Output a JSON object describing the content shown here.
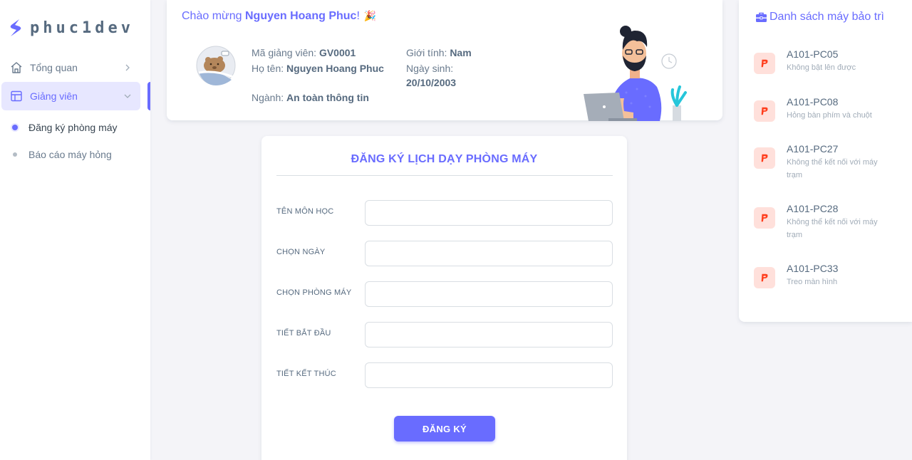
{
  "sidebar": {
    "brand": "phuc1dev",
    "menu": [
      {
        "label": "Tổng quan",
        "icon": "home-icon"
      },
      {
        "label": "Giảng viên",
        "icon": "layout-icon"
      }
    ],
    "submenu": [
      {
        "label": "Đăng ký phòng máy"
      },
      {
        "label": "Báo cáo máy hỏng"
      }
    ]
  },
  "welcome": {
    "greeting": "Chào mừng ",
    "name": "Nguyen Hoang Phuc",
    "suffix": "!",
    "emoji": "🎉",
    "teacher_id_label": "Mã giảng viên: ",
    "teacher_id": "GV0001",
    "fullname_label": "Họ tên: ",
    "fullname": "Nguyen Hoang Phuc",
    "major_label": "Ngành: ",
    "major": "An toàn thông tin",
    "gender_label": "Giới tính: ",
    "gender": "Nam",
    "dob_label": "Ngày sinh:",
    "dob": "20/10/2003"
  },
  "form": {
    "title": "ĐĂNG KÝ LỊCH DẠY PHÒNG MÁY",
    "fields": [
      {
        "label": "TÊN MÔN HỌC",
        "value": ""
      },
      {
        "label": "CHỌN NGÀY",
        "value": ""
      },
      {
        "label": "CHỌN PHÒNG MÁY",
        "value": ""
      },
      {
        "label": "TIẾT BẮT ĐẦU",
        "value": ""
      },
      {
        "label": "TIẾT KẾT THÚC",
        "value": ""
      }
    ],
    "submit_label": "ĐĂNG KÝ"
  },
  "maintenance": {
    "title": "Danh sách máy bảo trì",
    "items": [
      {
        "name": "A101-PC05",
        "desc": "Không bật lên được",
        "icon": "paypal-icon"
      },
      {
        "name": "A101-PC08",
        "desc": "Hỏng bàn phím và chuột",
        "icon": "paypal-icon"
      },
      {
        "name": "A101-PC27",
        "desc": "Không thể kết nối với máy trạm",
        "icon": "paypal-icon"
      },
      {
        "name": "A101-PC28",
        "desc": "Không thể kết nối với máy trạm",
        "icon": "paypal-icon"
      },
      {
        "name": "A101-PC33",
        "desc": "Treo màn hình",
        "icon": "paypal-icon"
      }
    ]
  },
  "colors": {
    "primary": "#696cff",
    "primary_light": "#e7e7ff",
    "danger_light": "#ffe0db",
    "danger": "#ff3e1d",
    "background": "#f4f4f8"
  }
}
